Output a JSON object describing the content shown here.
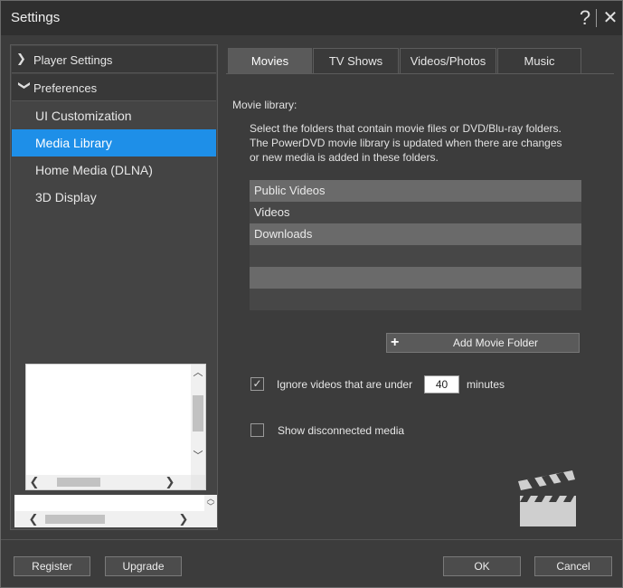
{
  "window": {
    "title": "Settings",
    "help_glyph": "?",
    "close_glyph": "✕"
  },
  "sidebar": {
    "groups": [
      {
        "label": "Player Settings",
        "chevron": "❯"
      },
      {
        "label": "Preferences",
        "chevron": "❯"
      }
    ],
    "items": [
      {
        "label": "UI Customization"
      },
      {
        "label": "Media Library",
        "selected": true
      },
      {
        "label": "Home Media (DLNA)"
      },
      {
        "label": "3D Display"
      }
    ]
  },
  "tabs": [
    {
      "label": "Movies",
      "active": true
    },
    {
      "label": "TV Shows"
    },
    {
      "label": "Videos/Photos"
    },
    {
      "label": "Music"
    }
  ],
  "movies": {
    "section_label": "Movie library:",
    "description": [
      "Select the folders that contain movie files or DVD/Blu-ray folders.",
      "The PowerDVD movie library is updated when there are changes",
      "or new media is added in these folders."
    ],
    "folders": [
      "Public Videos",
      "Videos",
      "Downloads",
      "",
      "",
      ""
    ],
    "add_button_label": "Add Movie Folder",
    "ignore_label": "Ignore videos that are under",
    "ignore_checked": true,
    "ignore_minutes": "40",
    "minutes_label": "minutes",
    "show_disconnected_label": "Show disconnected media",
    "show_disconnected_checked": false
  },
  "buttons": {
    "register": "Register",
    "upgrade": "Upgrade",
    "ok": "OK",
    "cancel": "Cancel"
  },
  "icons": {
    "check": "✓",
    "plus": "+",
    "scroll_up": "︿",
    "scroll_down": "﹀",
    "scroll_left": "❮",
    "scroll_right": "❯"
  },
  "colors": {
    "selection": "#1e8fe8",
    "background": "#3c3c3c"
  }
}
